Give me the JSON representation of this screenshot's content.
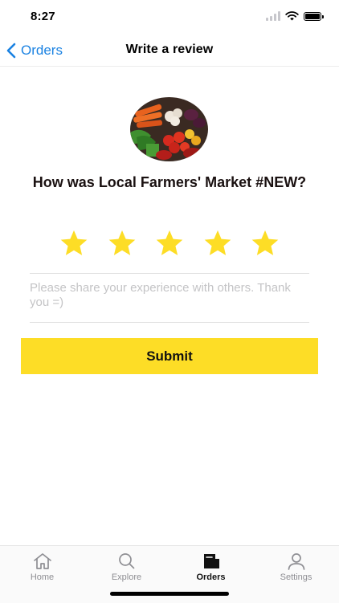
{
  "status_bar": {
    "time": "8:27"
  },
  "nav": {
    "back_label": "Orders",
    "title": "Write a review"
  },
  "review": {
    "question": "How was Local Farmers' Market #NEW?",
    "rating": 5,
    "rating_max": 5,
    "placeholder": "Please share your experience with others. Thank you =)",
    "value": "",
    "submit_label": "Submit"
  },
  "tabs": [
    {
      "label": "Home",
      "icon": "home-icon",
      "active": false
    },
    {
      "label": "Explore",
      "icon": "search-icon",
      "active": false
    },
    {
      "label": "Orders",
      "icon": "orders-icon",
      "active": true
    },
    {
      "label": "Settings",
      "icon": "person-icon",
      "active": false
    }
  ],
  "colors": {
    "accent": "#1a82e2",
    "star": "#fddd26",
    "submit_bg": "#fddd26",
    "active_tab": "#111111",
    "inactive_tab": "#8e8e93"
  }
}
